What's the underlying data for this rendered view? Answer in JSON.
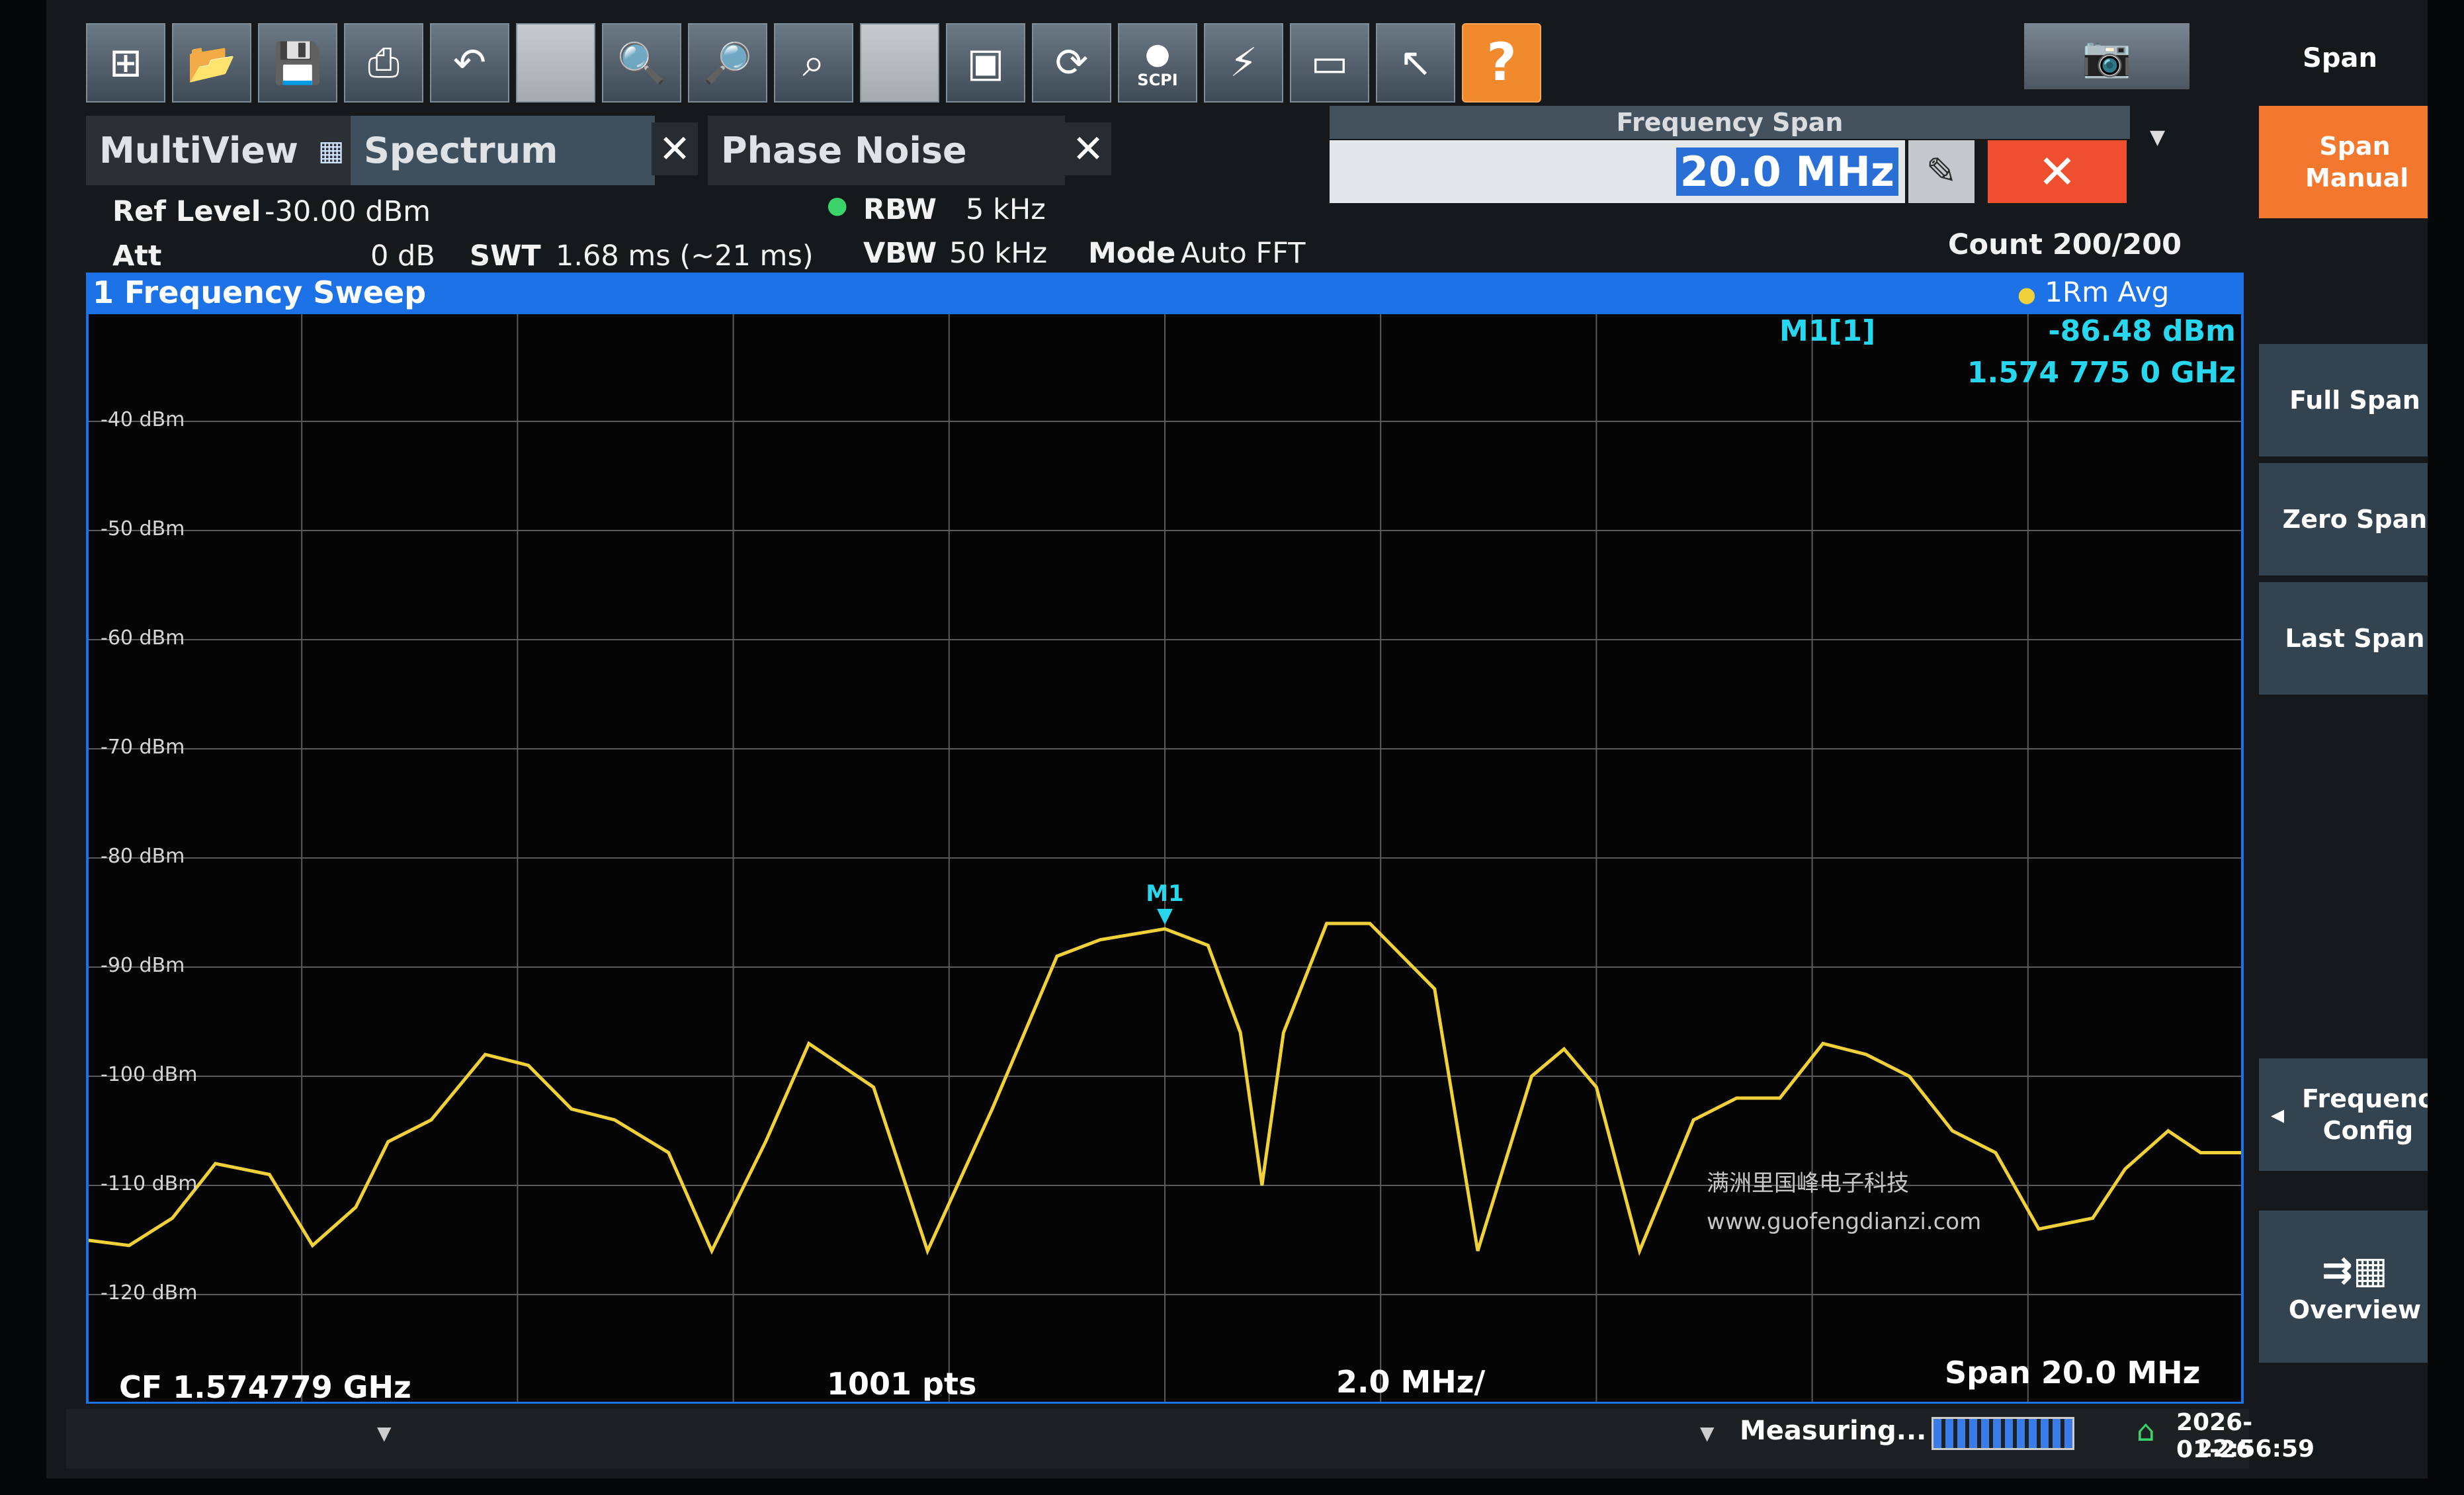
{
  "toolbar": {
    "buttons": [
      "windows",
      "open",
      "save",
      "print",
      "undo",
      "blank",
      "zoom",
      "multi-zoom",
      "zoom-off",
      "zoom-1-1",
      "fullscreen",
      "refresh",
      "scpi",
      "sequencer",
      "display-config",
      "help-pointer",
      "help"
    ],
    "blank_label": "",
    "scpi_label": "SCPI",
    "help_glyph": "?"
  },
  "tabs": {
    "multiview": "MultiView",
    "spectrum": "Spectrum",
    "phase_noise": "Phase Noise"
  },
  "span_dialog": {
    "title": "Frequency Span",
    "value": "20.0 MHz"
  },
  "settings": {
    "ref_level_label": "Ref Level",
    "ref_level_value": "-30.00 dBm",
    "att_label": "Att",
    "att_value": "0 dB",
    "swt_label": "SWT",
    "swt_value": "1.68 ms (~21 ms)",
    "rbw_label": "RBW",
    "rbw_value": "5 kHz",
    "vbw_label": "VBW",
    "vbw_value": "50 kHz",
    "mode_label": "Mode",
    "mode_value": "Auto FFT",
    "count": "Count 200/200"
  },
  "diagram": {
    "title": "1 Frequency Sweep",
    "trace_label": "1Rm Avg",
    "marker_name": "M1[1]",
    "marker_level": "-86.48 dBm",
    "marker_freq": "1.574 775 0 GHz",
    "marker_tag": "M1",
    "y_labels": [
      "-40 dBm",
      "-50 dBm",
      "-60 dBm",
      "-70 dBm",
      "-80 dBm",
      "-90 dBm",
      "-100 dBm",
      "-110 dBm",
      "-120 dBm"
    ],
    "cf": "CF 1.574779 GHz",
    "pts": "1001 pts",
    "div": "2.0 MHz/",
    "span": "Span 20.0 MHz"
  },
  "chart_data": {
    "type": "line",
    "xlabel": "",
    "ylabel": "",
    "ylim": [
      -130,
      -30
    ],
    "y_ticks": [
      -40,
      -50,
      -60,
      -70,
      -80,
      -90,
      -100,
      -110,
      -120
    ],
    "x_unit": "MHz offset from CF",
    "xlim": [
      -10,
      10
    ],
    "grid": true,
    "series": [
      {
        "name": "1Rm Avg",
        "color": "#f1d13a",
        "x": [
          -10.0,
          -9.6,
          -9.2,
          -8.8,
          -8.3,
          -7.9,
          -7.5,
          -7.2,
          -6.8,
          -6.3,
          -5.9,
          -5.5,
          -5.1,
          -4.6,
          -4.2,
          -3.7,
          -3.3,
          -2.7,
          -2.2,
          -1.6,
          -1.0,
          -0.6,
          0.0,
          0.4,
          0.7,
          0.9,
          1.1,
          1.5,
          1.9,
          2.5,
          2.9,
          3.4,
          3.7,
          4.0,
          4.4,
          4.9,
          5.3,
          5.7,
          6.1,
          6.5,
          6.9,
          7.3,
          7.7,
          8.1,
          8.6,
          8.9,
          9.3,
          9.6,
          10.0
        ],
        "y": [
          -115,
          -115.5,
          -113,
          -108,
          -109,
          -115.5,
          -112,
          -106,
          -104,
          -98,
          -99,
          -103,
          -104,
          -107,
          -116,
          -106,
          -97,
          -101,
          -116,
          -103,
          -89,
          -87.5,
          -86.5,
          -88,
          -96,
          -110,
          -96,
          -86,
          -86,
          -92,
          -116,
          -100,
          -97.5,
          -101,
          -116,
          -104,
          -102,
          -102,
          -97,
          -98,
          -100,
          -105,
          -107,
          -114,
          -113,
          -108.5,
          -105,
          -107,
          -107
        ]
      }
    ],
    "marker": {
      "name": "M1",
      "x": 0.0,
      "y": -86.48
    }
  },
  "footer": {
    "measuring": "Measuring...",
    "date": "2026-01-26",
    "time": "22:56:59"
  },
  "softkeys": {
    "title": "Span",
    "span_manual": "Span Manual",
    "full_span": "Full Span",
    "zero_span": "Zero Span",
    "last_span": "Last Span",
    "frequency_config": "Frequency Config",
    "overview": "Overview"
  },
  "watermark": {
    "line1": "满洲里国峰电子科技",
    "line2": "www.guofengdianzi.com"
  }
}
